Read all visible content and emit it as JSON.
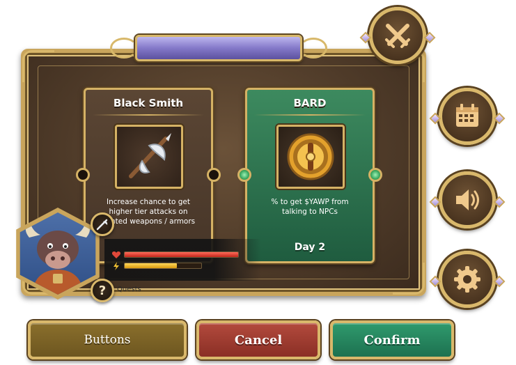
{
  "banner": {
    "title": ""
  },
  "cards": [
    {
      "title": "Black Smith",
      "description": "Increase chance to get higher tier attacks on minted weapons / armors",
      "art_icon": "battle-axe-icon",
      "theme": "brown"
    },
    {
      "title": "BARD",
      "description": "% to get $YAWP from talking to NPCs",
      "art_icon": "shield-drum-icon",
      "footer": "Day 2",
      "theme": "green"
    }
  ],
  "side_menu": [
    {
      "icon": "crossed-swords-icon"
    },
    {
      "icon": "calendar-icon"
    },
    {
      "icon": "speaker-icon"
    },
    {
      "icon": "gear-icon"
    }
  ],
  "player": {
    "avatar": "bull-warrior-portrait",
    "hp_fraction": 1.0,
    "energy_fraction": 0.68,
    "quests_label": "Quests"
  },
  "buttons": {
    "primary_label": "Buttons",
    "cancel_label": "Cancel",
    "confirm_label": "Confirm"
  },
  "colors": {
    "gold": "#d9b86b",
    "wood": "#4f3b29",
    "bard_green": "#2f7a52",
    "banner_purple": "#8479c9",
    "cancel_red": "#a23e32",
    "confirm_green": "#279062",
    "buttons_gold": "#7d6427"
  }
}
